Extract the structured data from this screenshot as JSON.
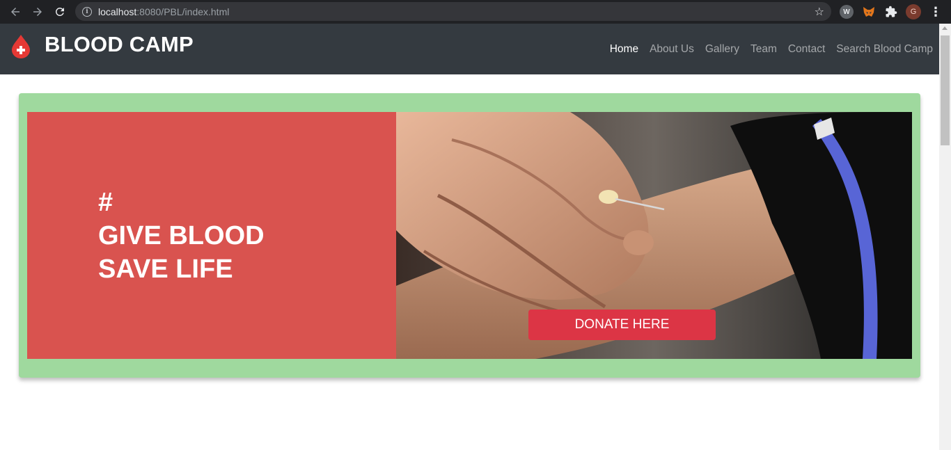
{
  "browser": {
    "url_host": "localhost",
    "url_path": ":8080/PBL/index.html",
    "avatar_initial": "G",
    "ext_w_label": "W"
  },
  "site": {
    "brand_title": "BLOOD CAMP",
    "nav": [
      {
        "label": "Home",
        "active": true
      },
      {
        "label": "About Us",
        "active": false
      },
      {
        "label": "Gallery",
        "active": false
      },
      {
        "label": "Team",
        "active": false
      },
      {
        "label": "Contact",
        "active": false
      },
      {
        "label": "Search Blood Camp",
        "active": false
      }
    ]
  },
  "hero": {
    "line1": "#",
    "line2": "GIVE BLOOD",
    "line3": "SAVE LIFE",
    "donate_label": "DONATE HERE"
  },
  "colors": {
    "navbar": "#343a40",
    "hero_bg": "#9fd99e",
    "hero_left": "#d9534f",
    "donate": "#dc3545"
  }
}
